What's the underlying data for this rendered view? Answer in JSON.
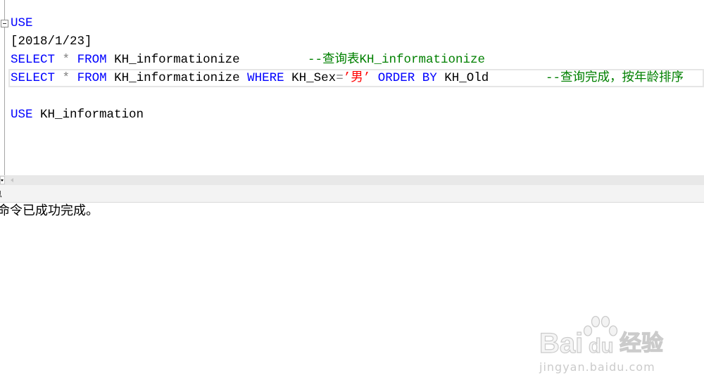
{
  "editor": {
    "line1": {
      "keyword": "USE"
    },
    "line2": {
      "text": "[2018/1/23]"
    },
    "line3": {
      "select": "SELECT",
      "star": "*",
      "from": "FROM",
      "table": "KH_informationize",
      "comment": "--查询表KH_informationize"
    },
    "line4": {
      "select": "SELECT",
      "star": "*",
      "from": "FROM",
      "table": "KH_informationize",
      "where": "WHERE",
      "column": "KH_Sex",
      "operator": "=",
      "value": "’男’",
      "order_by": "ORDER BY",
      "order_column": "KH_Old",
      "comment": "--查询完成，按年龄排序"
    },
    "line6": {
      "keyword": "USE",
      "database": "KH_information"
    }
  },
  "results": {
    "tab_label": "息",
    "message": "命令已成功完成。"
  },
  "icons": {
    "collapse": "collapse-minus-icon",
    "zoom": "chevron-down-icon",
    "scroll_left": "arrow-left-icon",
    "watermark": "paw-icon"
  },
  "watermark": {
    "brand_latin_1": "Bai",
    "brand_latin_2": "du",
    "brand_cjk": "经验",
    "url": "jingyan.baidu.com"
  },
  "colors": {
    "keyword": "#0000FF",
    "identifier": "#000000",
    "operator": "#808080",
    "string": "#FF0000",
    "comment": "#008000",
    "current_line_border": "#E6E6E6",
    "scrollbar": "#E8E8E8",
    "watermark": "#CBCBCB"
  }
}
